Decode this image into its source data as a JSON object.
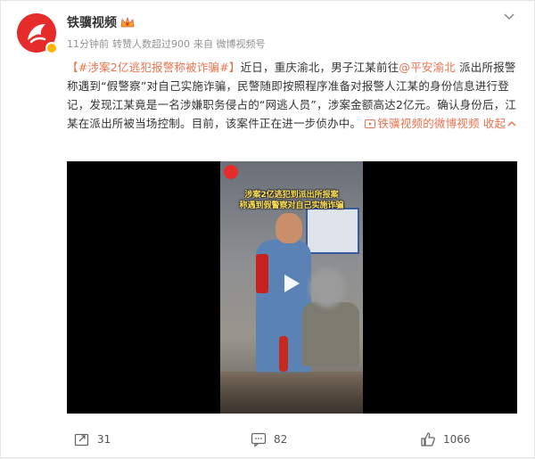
{
  "author": {
    "name": "铁骥视频",
    "crown_icon": "crown-icon"
  },
  "meta": {
    "time": "11分钟前",
    "reposts_note": "转赞人数超过900",
    "from": "来自 微博视频号"
  },
  "post": {
    "hashtag": "【#涉案2亿逃犯报警称被诈骗#】",
    "text_1": "近日，重庆渝北，男子江某前往",
    "mention": "@平安渝北",
    "text_2": " 派出所报警称遇到“假警察”对自己实施诈骗，民警随即按照程序准备对报警人江某的身份信息进行登记，发现江某竟是一名涉嫌职务侵占的“网逃人员”，涉案金额高达2亿元。确认身份后，江某在派出所被当场控制。目前，该案件正在进一步侦办中。",
    "video_link": "铁骥视频的微博视频",
    "collapse": " 收起",
    "collapse_icon": "chevron-up-icon"
  },
  "video": {
    "caption_line1": "涉案2亿逃犯到派出所报案",
    "caption_line2": "称遇到假警察对自己实施诈骗"
  },
  "actions": {
    "repost_count": "31",
    "comment_count": "82",
    "like_count": "1066"
  },
  "colors": {
    "accent": "#eb7350",
    "brand": "#e62b2b"
  }
}
